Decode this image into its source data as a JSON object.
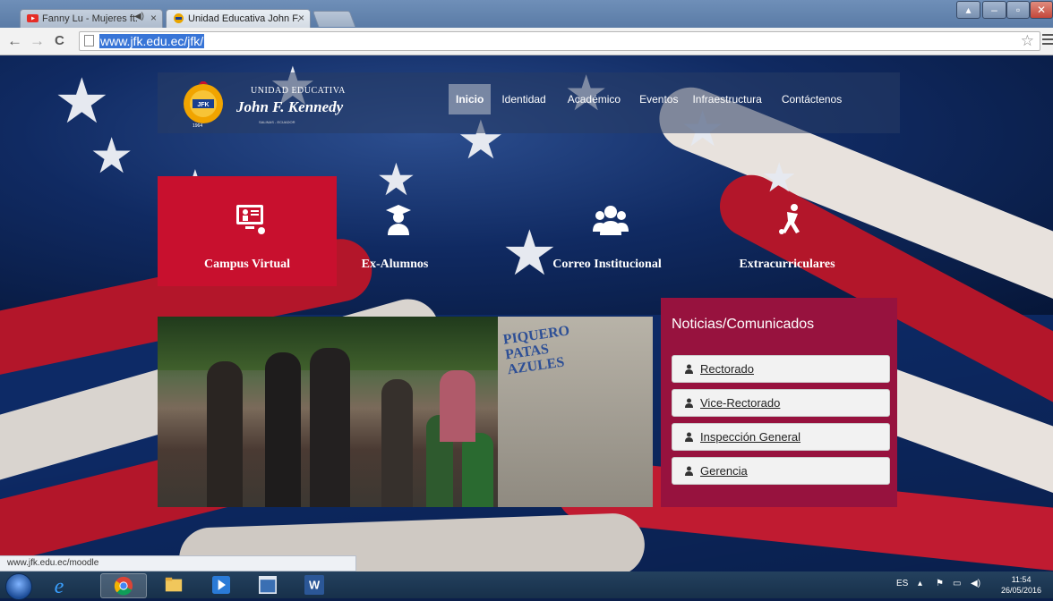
{
  "browser": {
    "tabs": [
      {
        "title": "Fanny Lu - Mujeres ft.",
        "active": false,
        "audio": true
      },
      {
        "title": "Unidad Educativa John F.",
        "active": true,
        "audio": false
      }
    ],
    "url": "www.jfk.edu.ec/jfk/",
    "status_url": "www.jfk.edu.ec/moodle"
  },
  "site": {
    "logo": {
      "line1": "UNIDAD EDUCATIVA",
      "line2": "John F. Kennedy",
      "line3": "SALINAS - ECUADOR",
      "year": "1964"
    },
    "nav": [
      {
        "label": "Inicio",
        "active": true
      },
      {
        "label": "Identidad",
        "active": false
      },
      {
        "label": "Académico",
        "active": false
      },
      {
        "label": "Eventos",
        "active": false
      },
      {
        "label": "Infraestructura",
        "active": false
      },
      {
        "label": "Contáctenos",
        "active": false
      }
    ],
    "tiles": [
      {
        "label": "Campus Virtual",
        "icon": "computer-user-icon"
      },
      {
        "label": "Ex-Alumnos",
        "icon": "graduate-icon"
      },
      {
        "label": "Correo Institucional",
        "icon": "group-icon"
      },
      {
        "label": "Extracurriculares",
        "icon": "soccer-player-icon"
      }
    ],
    "photo": {
      "sign_text": "PIQUERO PATAS AZULES"
    },
    "news": {
      "title": "Noticias/Comunicados",
      "items": [
        "Rectorado",
        "Vice-Rectorado",
        "Inspección General",
        "Gerencia"
      ]
    }
  },
  "taskbar": {
    "apps": [
      "start-orb",
      "internet-explorer-icon",
      "chrome-icon",
      "file-explorer-icon",
      "media-player-icon",
      "window-icon",
      "word-icon"
    ],
    "language": "ES",
    "time": "11:54",
    "date": "26/05/2016"
  },
  "colors": {
    "accent_red": "#c8102e",
    "news_bg": "#97123e"
  }
}
